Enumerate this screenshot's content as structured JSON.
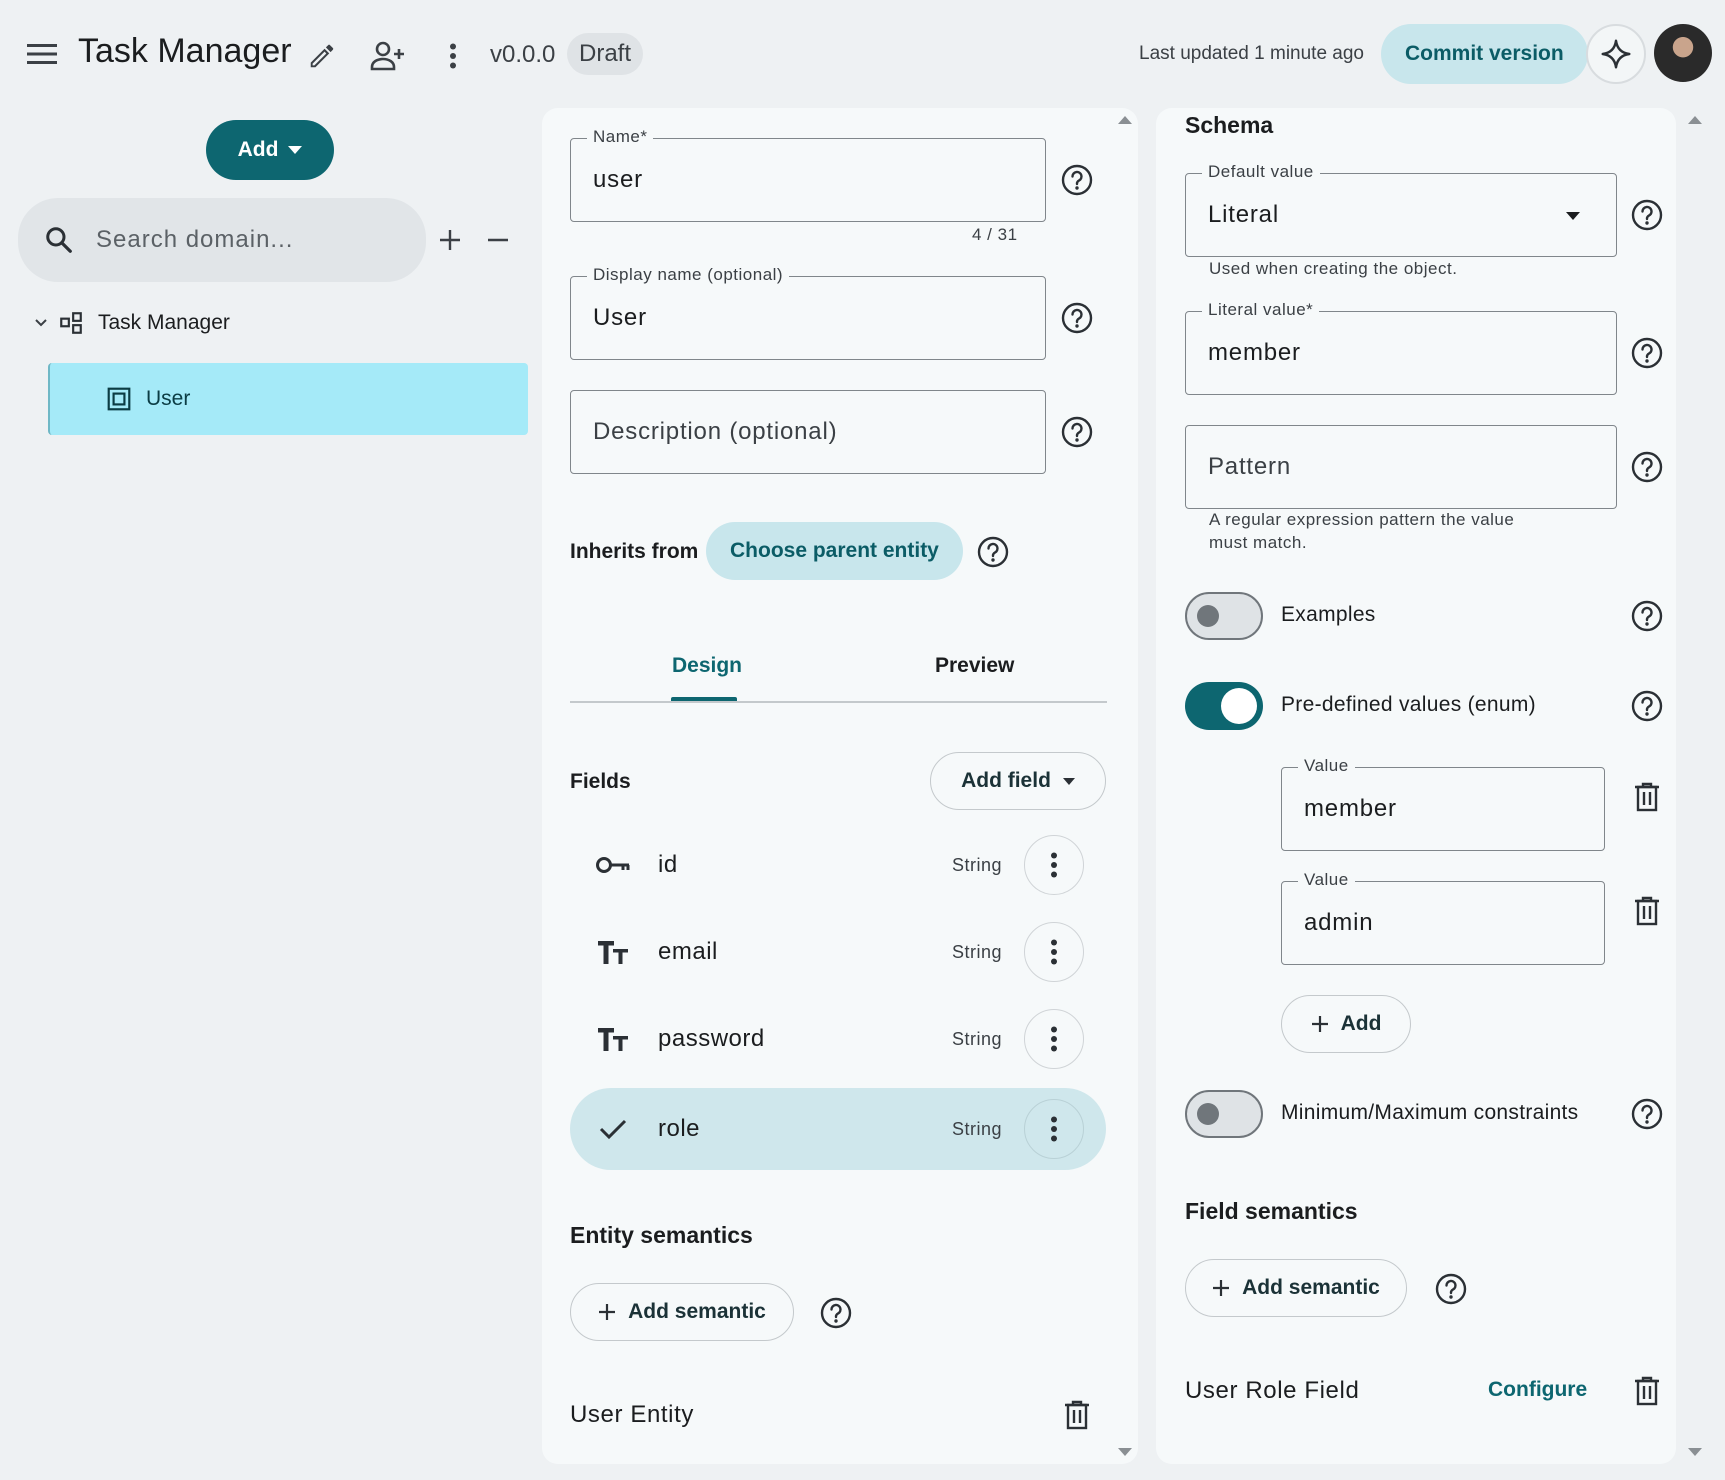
{
  "header": {
    "app_title": "Task Manager",
    "version": "v0.0.0",
    "status": "Draft",
    "last_updated": "Last updated 1 minute ago",
    "commit_label": "Commit version"
  },
  "sidebar": {
    "add_label": "Add",
    "search_placeholder": "Search domain...",
    "tree_root": "Task Manager",
    "tree_item": "User"
  },
  "entity_form": {
    "name_label": "Name*",
    "name_value": "user",
    "name_counter": "4 / 31",
    "display_name_label": "Display name (optional)",
    "display_name_value": "User",
    "description_placeholder": "Description (optional)",
    "inherits_label": "Inherits from",
    "choose_parent_label": "Choose parent entity",
    "tabs": [
      "Design",
      "Preview"
    ],
    "active_tab": "Design",
    "fields_title": "Fields",
    "add_field_label": "Add field",
    "fields": [
      {
        "name": "id",
        "type": "String",
        "icon": "key-icon"
      },
      {
        "name": "email",
        "type": "String",
        "icon": "text-type-icon"
      },
      {
        "name": "password",
        "type": "String",
        "icon": "text-type-icon"
      },
      {
        "name": "role",
        "type": "String",
        "icon": "check-icon"
      }
    ],
    "selected_field": "role",
    "entity_semantics_title": "Entity semantics",
    "add_semantic_label": "Add semantic",
    "semantic_item": "User Entity"
  },
  "schema": {
    "title": "Schema",
    "default_value_label": "Default value",
    "default_value": "Literal",
    "default_value_hint": "Used when creating the object.",
    "literal_value_label": "Literal value*",
    "literal_value": "member",
    "pattern_placeholder": "Pattern",
    "pattern_hint": "A regular expression pattern the value must match.",
    "examples_label": "Examples",
    "examples_enabled": false,
    "enum_label": "Pre-defined values (enum)",
    "enum_enabled": true,
    "enum_value_label": "Value",
    "enum_values": [
      "member",
      "admin"
    ],
    "add_value_label": "Add",
    "minmax_label": "Minimum/Maximum constraints",
    "minmax_enabled": false,
    "field_semantics_title": "Field semantics",
    "add_semantic_label": "Add semantic",
    "semantic_item": "User Role Field",
    "configure_label": "Configure"
  },
  "colors": {
    "accent": "#0d6670",
    "accent_light": "#c8e6ec",
    "selected_tree": "#a5eaf8",
    "background": "#eef1f3"
  }
}
